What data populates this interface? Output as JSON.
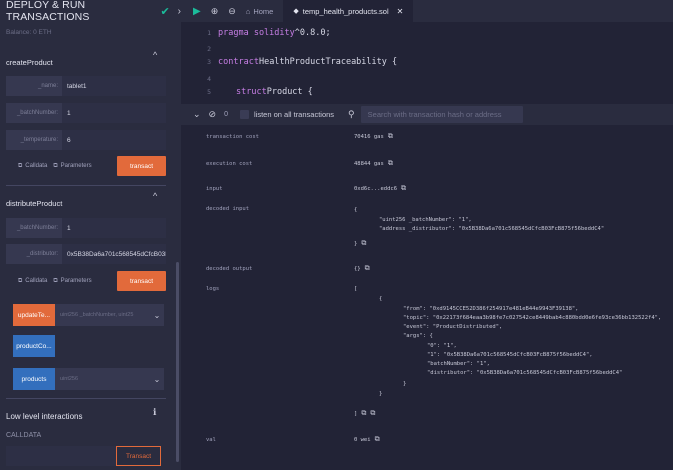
{
  "panel": {
    "title": "DEPLOY & RUN TRANSACTIONS",
    "balance": "Balance: 0 ETH"
  },
  "createProduct": {
    "title": "createProduct",
    "fields": [
      {
        "label": "_name:",
        "value": "tablet1"
      },
      {
        "label": "_batchNumber:",
        "value": "1"
      },
      {
        "label": "_temperature:",
        "value": "6"
      }
    ],
    "calldata": "Calldata",
    "parameters": "Parameters",
    "transact": "transact"
  },
  "distributeProduct": {
    "title": "distributeProduct",
    "fields": [
      {
        "label": "_batchNumber:",
        "value": "1"
      },
      {
        "label": "_distributor:",
        "value": "0x5B38Da6a701c568545dCfcB03F"
      }
    ],
    "calldata": "Calldata",
    "parameters": "Parameters",
    "transact": "transact"
  },
  "functions": [
    {
      "label": "updateTe...",
      "arg": "uint256 _batchNumber, uint25",
      "color": "#e26a3b"
    },
    {
      "label": "productCo...",
      "arg": "",
      "color": "#336fbd"
    },
    {
      "label": "products",
      "arg": "uint256",
      "color": "#336fbd"
    }
  ],
  "lowLevel": {
    "title": "Low level interactions",
    "calldata": "CALLDATA",
    "transact": "Transact"
  },
  "tabs": {
    "home": "Home",
    "file": "temp_health_products.sol"
  },
  "code": [
    {
      "n": "1",
      "kw": "pragma solidity",
      "text": " ^0.8.0;"
    },
    {
      "n": "2",
      "kw": "",
      "text": ""
    },
    {
      "n": "3",
      "kw": "contract",
      "text": " HealthProductTraceability {"
    },
    {
      "n": "4",
      "kw": "",
      "text": ""
    },
    {
      "n": "5",
      "kw": "struct",
      "text": " Product {"
    }
  ],
  "terminal": {
    "count": "0",
    "listen": "listen on all transactions",
    "search_placeholder": "Search with transaction hash or address"
  },
  "tx": {
    "transaction_cost_label": "transaction cost",
    "transaction_cost": "70416 gas",
    "execution_cost_label": "execution cost",
    "execution_cost": "48844 gas",
    "input_label": "input",
    "input": "0xd6c...eddc6",
    "decoded_input_label": "decoded input",
    "decoded_input_open": "{",
    "decoded_input_line1": "\"uint256 _batchNumber\": \"1\",",
    "decoded_input_line2": "\"address _distributor\": \"0x5B38Da6a701c568545dCfcB03FcB875f56beddC4\"",
    "decoded_input_close": "}",
    "decoded_output_label": "decoded output",
    "decoded_output": "{}",
    "logs_label": "logs",
    "logs_lines": [
      "[",
      "{",
      "\"from\": \"0xd9145CCE52D386f254917e481eB44e9943F39138\",",
      "\"topic\": \"0x22173f684eaa3b98fe7c027542ce8449bab4c880bdd0e6fe93ce36bb132522f4\",",
      "\"event\": \"ProductDistributed\",",
      "\"args\": {",
      "\"0\": \"1\",",
      "\"1\": \"0x5B38Da6a701c568545dCfcB03FcB875f56beddC4\",",
      "\"batchNumber\": \"1\",",
      "\"distributor\": \"0x5B38Da6a701c568545dCfcB03FcB875f56beddC4\"",
      "}",
      "}",
      "]"
    ],
    "val_label": "val",
    "val": "0 wei"
  },
  "colors": {
    "accent_orange": "#e26a3b",
    "accent_blue": "#336fbd",
    "success_green": "#1bbc9b"
  }
}
